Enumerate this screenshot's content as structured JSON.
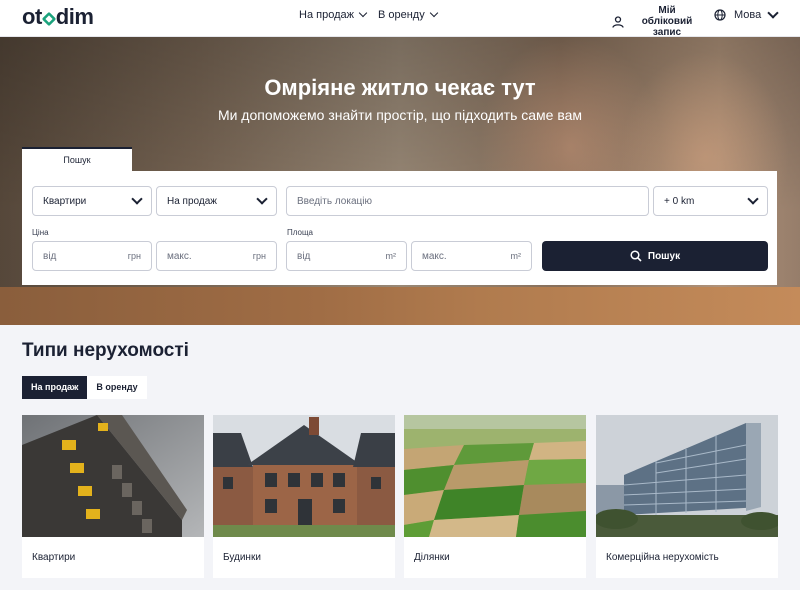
{
  "header": {
    "logo": "otodim",
    "nav": [
      {
        "label": "На продаж"
      },
      {
        "label": "В оренду"
      }
    ],
    "account_label": "Мій обліковий запис",
    "language_label": "Мова"
  },
  "hero": {
    "title": "Омріяне житло чекає тут",
    "subtitle": "Ми допоможемо знайти простір, що підходить саме вам"
  },
  "search": {
    "tab_label": "Пошук",
    "property_type": "Квартири",
    "deal_type": "На продаж",
    "location_placeholder": "Введіть локацію",
    "radius": "+ 0 km",
    "price_label": "Ціна",
    "price_from_placeholder": "від",
    "price_to_placeholder": "макс.",
    "price_unit": "грн",
    "area_label": "Площа",
    "area_from_placeholder": "від",
    "area_to_placeholder": "макс.",
    "area_unit": "m²",
    "submit_label": "Пошук"
  },
  "property_types": {
    "title": "Типи нерухомості",
    "tabs": [
      {
        "label": "На продаж",
        "active": true
      },
      {
        "label": "В оренду",
        "active": false
      }
    ],
    "cards": [
      {
        "label": "Квартири",
        "image": "apartment-building"
      },
      {
        "label": "Будинки",
        "image": "brick-house"
      },
      {
        "label": "Ділянки",
        "image": "farmland-plots"
      },
      {
        "label": "Комерційна нерухомість",
        "image": "glass-office-building"
      }
    ]
  },
  "colors": {
    "primary": "#1b2133",
    "accent": "#1ba37d"
  }
}
